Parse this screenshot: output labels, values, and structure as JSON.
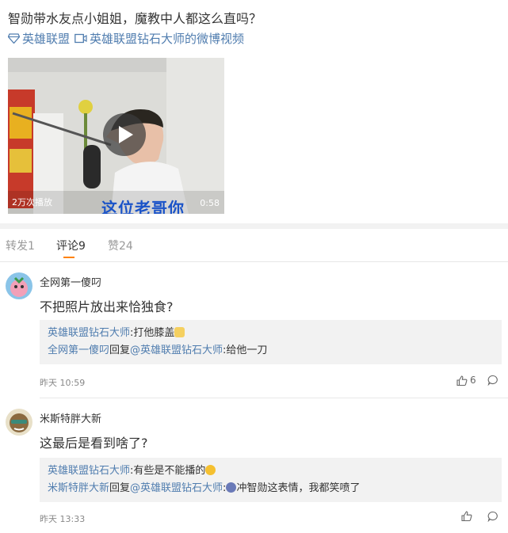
{
  "post": {
    "text": "智勋带水友点小姐姐，魔教中人都这么直吗？",
    "topic_link": "英雄联盟",
    "video_link": "英雄联盟钻石大师的微博视频"
  },
  "video": {
    "play_count": "2万次播放",
    "duration": "0:58",
    "caption": "这位老哥你"
  },
  "tabs": [
    {
      "label": "转发1",
      "active": false
    },
    {
      "label": "评论9",
      "active": true
    },
    {
      "label": "赞24",
      "active": false
    }
  ],
  "comments": [
    {
      "user": "全网第一傻叼",
      "text": "不把照片放出来恰独食?",
      "replies": [
        {
          "author": "英雄联盟钻石大师",
          "mention": "",
          "text": ":打他膝盖"
        },
        {
          "author": "全网第一傻叼",
          "mention": "@英雄联盟钻石大师",
          "text": ":给他一刀"
        }
      ],
      "time": "昨天 10:59",
      "likes": "6"
    },
    {
      "user": "米斯特胖大新",
      "text": "这最后是看到啥了?",
      "replies": [
        {
          "author": "英雄联盟钻石大师",
          "mention": "",
          "text": ":有些是不能播的"
        },
        {
          "author": "米斯特胖大新",
          "mention": "@英雄联盟钻石大师",
          "text": "冲智勋这表情，我都笑喷了"
        }
      ],
      "time": "昨天 13:33",
      "likes": ""
    }
  ],
  "reply_verb": "回复",
  "colors": {
    "link": "#507daf",
    "accent": "#ff8200",
    "reply_bg": "#f2f2f2"
  }
}
